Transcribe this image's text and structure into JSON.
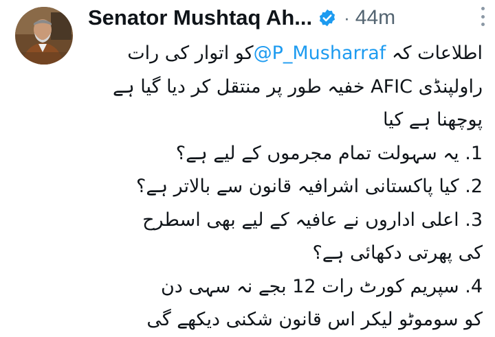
{
  "author": {
    "name": "Senator Mushtaq Ah...",
    "verified_icon": "verified-badge-icon",
    "separator": "·",
    "time": "44m"
  },
  "tweet": {
    "lines": [
      {
        "before": "اطلاعات کہ",
        "mention": "@P_Musharraf",
        "after": "کو اتوار کی رات"
      },
      {
        "text": "راولپنڈی AFIC خفیہ طور پر منتقل کر دیا گیا ہے"
      },
      {
        "text": "پوچھنا ہے کیا"
      },
      {
        "text": "1. یہ سہولت تمام مجرموں کے لیے ہے؟"
      },
      {
        "text": "2. کیا پاکستانی اشرافیہ قانون سے بالاتر ہے؟"
      },
      {
        "text": "3. اعلی اداروں نے عافیہ کے لیے بھی اسطرح"
      },
      {
        "text": "کی پھرتی دکھائی ہے؟"
      },
      {
        "text": "4. سپریم کورٹ رات 12 بجے نہ سہی دن"
      },
      {
        "text": "کو سوموٹو لیکر اس قانون شکنی دیکھے گی"
      }
    ]
  },
  "colors": {
    "text": "#0f1419",
    "secondary": "#536471",
    "accent": "#1d9bf0"
  }
}
